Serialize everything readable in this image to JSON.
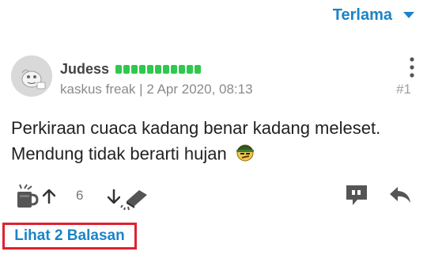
{
  "sort": {
    "label": "Terlama",
    "icon": "chevron-down-icon"
  },
  "post": {
    "username": "Judess",
    "reputation_segments": 11,
    "rank": "kaskus freak",
    "separator": "|",
    "timestamp": "2 Apr 2020, 08:13",
    "number": "#1",
    "content_line1": "Perkiraan cuaca kadang benar kadang meleset.",
    "content_line2": "Mendung tidak berarti hujan"
  },
  "actions": {
    "vote_count": "6"
  },
  "replies": {
    "label": "Lihat 2 Balasan"
  },
  "colors": {
    "accent": "#1b84c8",
    "reputation": "#2fc84f",
    "highlight": "#e0212f"
  }
}
